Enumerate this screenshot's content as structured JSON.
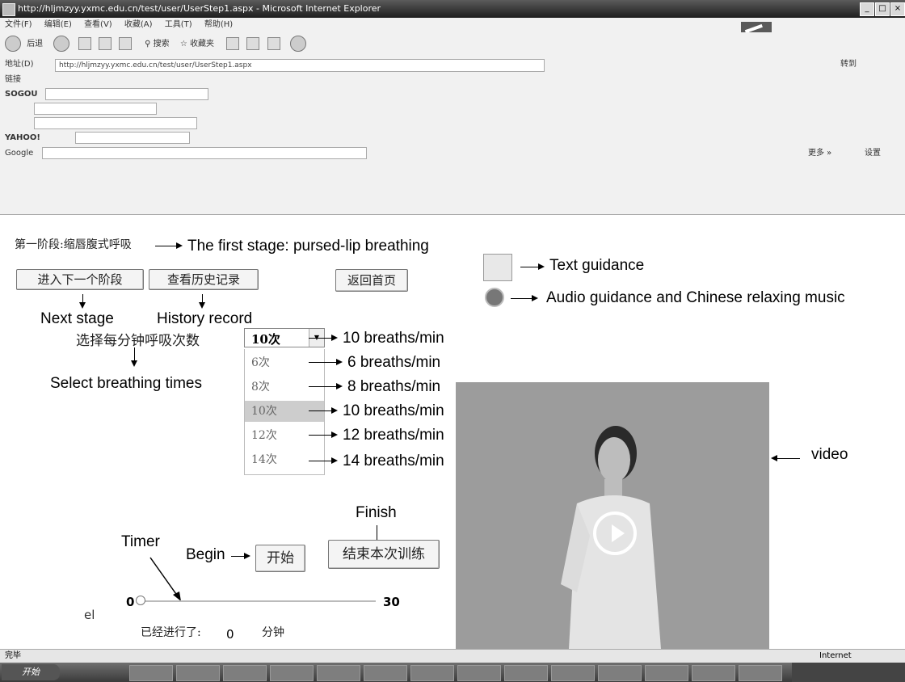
{
  "browser": {
    "title": "http://hljmzyy.yxmc.edu.cn/test/user/UserStep1.aspx - Microsoft Internet Explorer",
    "menu": [
      "文件(F)",
      "编辑(E)",
      "查看(V)",
      "收藏(A)",
      "工具(T)",
      "帮助(H)"
    ],
    "nav_back": "后退",
    "nav_search": "搜索",
    "nav_favorites": "收藏夹",
    "address_label": "地址(D)",
    "address_value": "http://hljmzyy.yxmc.edu.cn/test/user/UserStep1.aspx",
    "address_go": "转到",
    "links_label": "链接",
    "google_label": "Google",
    "more_label": "更多 »",
    "settings_label": "设置"
  },
  "page": {
    "stage_title": "第一阶段:缩唇腹式呼吸",
    "next_stage_btn": "进入下一个阶段",
    "history_btn": "查看历史记录",
    "home_btn": "返回首页",
    "select_label": "选择每分钟呼吸次数",
    "select_value": "10次",
    "options": [
      "6次",
      "8次",
      "10次",
      "12次",
      "14次"
    ],
    "selected_option_index": 2,
    "start_btn": "开始",
    "end_btn": "结束本次训练",
    "slider_min": "0",
    "slider_max": "30",
    "slider_value": 0,
    "elapsed_label": "已经进行了:",
    "elapsed_value": "0",
    "elapsed_unit": "分钟",
    "cut_text": "el"
  },
  "annotations": {
    "first_stage": "The first stage: pursed-lip breathing",
    "text_guidance": "Text guidance",
    "audio_guidance": "Audio guidance and Chinese relaxing music",
    "next_stage": "Next stage",
    "history_record": "History record",
    "select_breathing": "Select breathing times",
    "opt_current": "10 breaths/min",
    "opt_6": "6 breaths/min",
    "opt_8": "8 breaths/min",
    "opt_10": "10 breaths/min",
    "opt_12": "12 breaths/min",
    "opt_14": "14 breaths/min",
    "video": "video",
    "finish": "Finish",
    "timer": "Timer",
    "begin": "Begin"
  },
  "status": {
    "left": "完毕",
    "zone": "Internet",
    "start": "开始"
  },
  "icons": [
    "ie-logo-icon",
    "back-icon",
    "forward-icon",
    "stop-icon",
    "refresh-icon",
    "home-icon",
    "search-icon",
    "favorites-icon",
    "text-guidance-icon",
    "speaker-icon",
    "play-icon"
  ]
}
